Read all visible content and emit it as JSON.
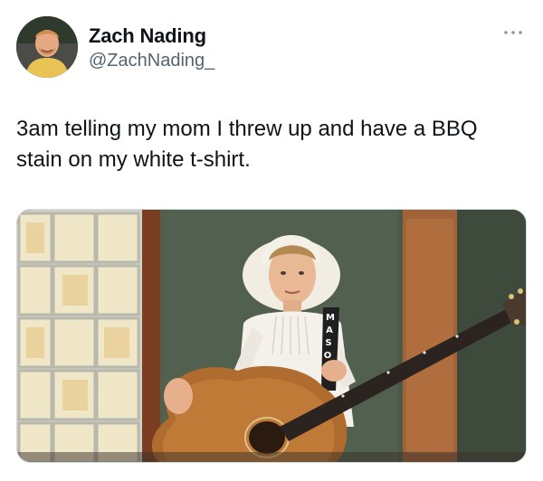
{
  "tweet": {
    "author": {
      "display_name": "Zach Nading",
      "handle": "@ZachNading_",
      "avatar_icon": "avatar-portrait"
    },
    "more_icon": "more-horizontal-icon",
    "text": "3am telling my mom I threw up and have a BBQ stain on my white t-shirt.",
    "media": {
      "type": "photo",
      "strap_letters": [
        "M",
        "A",
        "S",
        "O"
      ]
    }
  },
  "colors": {
    "text_primary": "#0f1419",
    "text_secondary": "#536471",
    "border": "#cfd9de"
  }
}
